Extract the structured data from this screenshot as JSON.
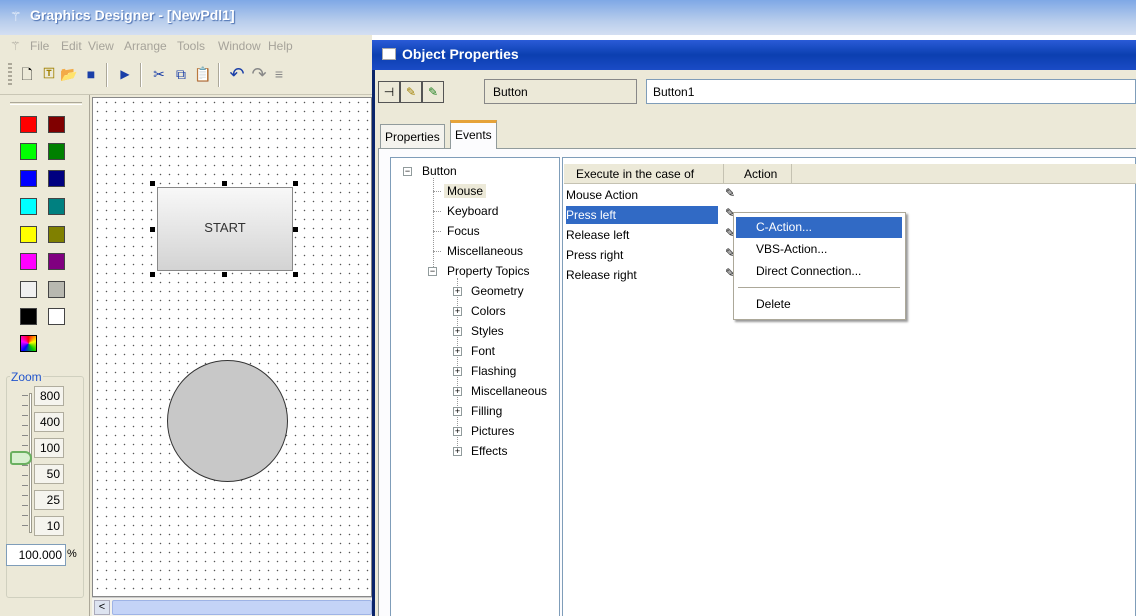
{
  "main_window": {
    "title": "Graphics Designer - [NewPdl1]",
    "menu": [
      "File",
      "Edit",
      "View",
      "Arrange",
      "Tools",
      "Window",
      "Help"
    ]
  },
  "zoom": {
    "label": "Zoom",
    "levels": [
      "800",
      "400",
      "100",
      "50",
      "25",
      "10"
    ],
    "value": "100.000",
    "unit": "%"
  },
  "canvas": {
    "start_button_text": "START"
  },
  "dialog": {
    "title": "Object Properties",
    "object_type": "Button",
    "object_name": "Button1",
    "tabs": [
      "Properties",
      "Events"
    ],
    "active_tab": "Events",
    "tree": {
      "root": "Button",
      "children": [
        "Mouse",
        "Keyboard",
        "Focus",
        "Miscellaneous"
      ],
      "property_topics": "Property Topics",
      "topics": [
        "Geometry",
        "Colors",
        "Styles",
        "Font",
        "Flashing",
        "Miscellaneous",
        "Filling",
        "Pictures",
        "Effects"
      ]
    },
    "columns": [
      "Execute in the case of",
      "Action"
    ],
    "rows": [
      "Mouse Action",
      "Press left",
      "Release left",
      "Press right",
      "Release right"
    ],
    "selected_row": "Press left"
  },
  "context_menu": {
    "items": [
      "C-Action...",
      "VBS-Action...",
      "Direct Connection...",
      "Delete"
    ],
    "highlighted": "C-Action..."
  },
  "colors": {
    "selection": "#316ac5",
    "dialog_title": "#0b3fb0",
    "swatches": [
      "#ff0000",
      "#800000",
      "#00ff00",
      "#008000",
      "#0000ff",
      "#000080",
      "#00ffff",
      "#008080",
      "#ffff00",
      "#808000",
      "#ff00ff",
      "#800080",
      "#ffffff",
      "#c0c0c0",
      "#000000",
      "#ffffff"
    ]
  }
}
